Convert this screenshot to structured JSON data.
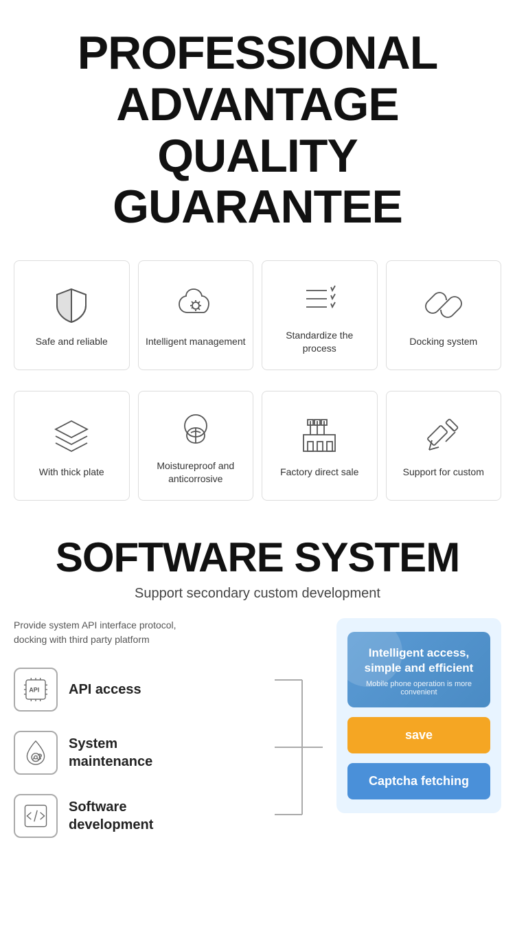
{
  "header": {
    "title_line1": "PROFESSIONAL",
    "title_line2": "ADVANTAGE",
    "title_line3": "QUALITY GUARANTEE"
  },
  "features_row1": [
    {
      "label": "Safe and reliable",
      "icon": "shield"
    },
    {
      "label": "Intelligent management",
      "icon": "cloud-settings"
    },
    {
      "label": "Standardize the process",
      "icon": "list-check"
    },
    {
      "label": "Docking system",
      "icon": "link"
    }
  ],
  "features_row2": [
    {
      "label": "With thick plate",
      "icon": "layers"
    },
    {
      "label": "Moistureproof and anticorrosive",
      "icon": "leaf"
    },
    {
      "label": "Factory direct sale",
      "icon": "factory"
    },
    {
      "label": "Support for custom",
      "icon": "pen-ruler"
    }
  ],
  "software": {
    "title": "SOFTWARE SYSTEM",
    "subtitle": "Support secondary custom development",
    "provide_text": "Provide system API interface protocol,\ndocking with third party platform",
    "features": [
      {
        "label": "API access",
        "icon": "api"
      },
      {
        "label": "System\nmaintenance",
        "icon": "drop-wrench"
      },
      {
        "label": "Software\ndevelopment",
        "icon": "code"
      }
    ],
    "panel": {
      "header_title": "Intelligent access, simple and efficient",
      "header_sub": "Mobile phone operation is more convenient",
      "btn_save": "save",
      "btn_captcha": "Captcha fetching"
    }
  }
}
